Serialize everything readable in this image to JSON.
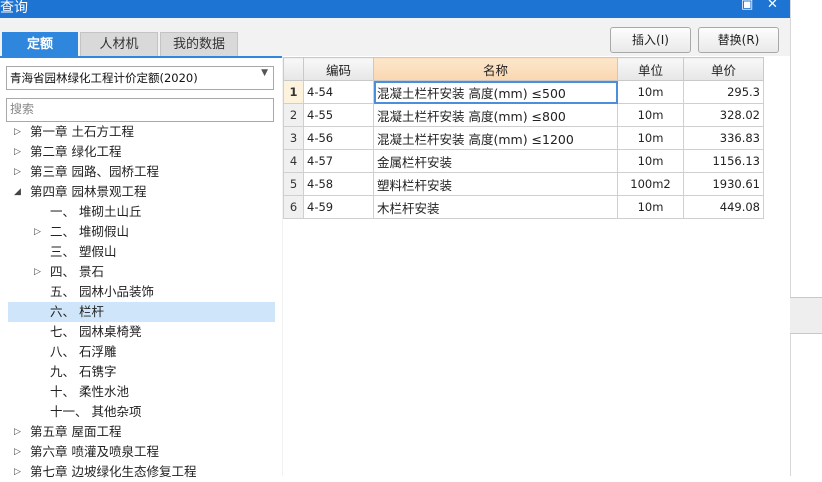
{
  "title": "查询",
  "title_controls": {
    "restore_icon": "restore-icon",
    "close_icon": "close-icon",
    "restore_glyph": "▣",
    "close_glyph": "✕"
  },
  "tabs": [
    {
      "label": "定额",
      "active": true
    },
    {
      "label": "人材机",
      "active": false
    },
    {
      "label": "我的数据",
      "active": false
    }
  ],
  "buttons": {
    "insert": "插入(I)",
    "replace": "替换(R)"
  },
  "library_select": {
    "value": "青海省园林绿化工程计价定额(2020)"
  },
  "search": {
    "placeholder": "搜索",
    "value": ""
  },
  "tree": [
    {
      "label": "第一章  土石方工程",
      "level": 0,
      "expander": "collapsed"
    },
    {
      "label": "第二章  绿化工程",
      "level": 0,
      "expander": "collapsed"
    },
    {
      "label": "第三章  园路、园桥工程",
      "level": 0,
      "expander": "collapsed"
    },
    {
      "label": "第四章  园林景观工程",
      "level": 0,
      "expander": "expanded"
    },
    {
      "label": "一、  堆砌土山丘",
      "level": 1,
      "expander": "none"
    },
    {
      "label": "二、  堆砌假山",
      "level": 1,
      "expander": "collapsed"
    },
    {
      "label": "三、  塑假山",
      "level": 1,
      "expander": "none"
    },
    {
      "label": "四、  景石",
      "level": 1,
      "expander": "collapsed"
    },
    {
      "label": "五、  园林小品装饰",
      "level": 1,
      "expander": "none"
    },
    {
      "label": "六、  栏杆",
      "level": 1,
      "expander": "none",
      "selected": true
    },
    {
      "label": "七、  园林桌椅凳",
      "level": 1,
      "expander": "none"
    },
    {
      "label": "八、  石浮雕",
      "level": 1,
      "expander": "none"
    },
    {
      "label": "九、  石镌字",
      "level": 1,
      "expander": "none"
    },
    {
      "label": "十、  柔性水池",
      "level": 1,
      "expander": "none"
    },
    {
      "label": "十一、  其他杂项",
      "level": 1,
      "expander": "none"
    },
    {
      "label": "第五章  屋面工程",
      "level": 0,
      "expander": "collapsed"
    },
    {
      "label": "第六章  喷灌及喷泉工程",
      "level": 0,
      "expander": "collapsed"
    },
    {
      "label": "第七章  边坡绿化生态修复工程",
      "level": 0,
      "expander": "collapsed"
    }
  ],
  "table": {
    "headers": {
      "code": "编码",
      "name": "名称",
      "unit": "单位",
      "price": "单价"
    },
    "rows": [
      {
        "no": "1",
        "code": "4-54",
        "name": "混凝土栏杆安装 高度(mm) ≤500",
        "unit": "10m",
        "price": "295.3"
      },
      {
        "no": "2",
        "code": "4-55",
        "name": "混凝土栏杆安装 高度(mm) ≤800",
        "unit": "10m",
        "price": "328.02"
      },
      {
        "no": "3",
        "code": "4-56",
        "name": "混凝土栏杆安装 高度(mm) ≤1200",
        "unit": "10m",
        "price": "336.83"
      },
      {
        "no": "4",
        "code": "4-57",
        "name": "金属栏杆安装",
        "unit": "10m",
        "price": "1156.13"
      },
      {
        "no": "5",
        "code": "4-58",
        "name": "塑料栏杆安装",
        "unit": "100m2",
        "price": "1930.61"
      },
      {
        "no": "6",
        "code": "4-59",
        "name": "木栏杆安装",
        "unit": "10m",
        "price": "449.08"
      }
    ]
  },
  "colors": {
    "title_bar": "#1e74d3",
    "active_tab": "#2f87dd",
    "selected_tree": "#cfe6fa",
    "name_header": "#f9d7b0"
  }
}
